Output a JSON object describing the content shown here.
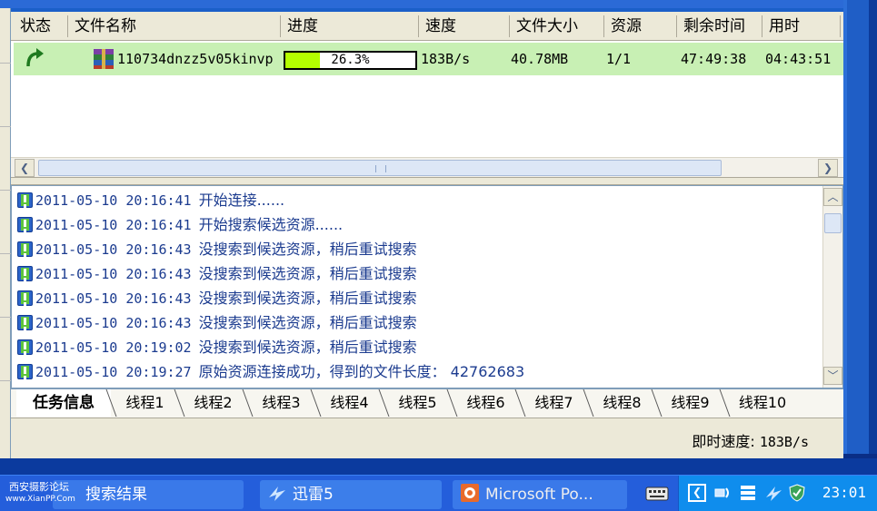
{
  "columns": [
    "状态",
    "文件名称",
    "进度",
    "速度",
    "文件大小",
    "资源",
    "剩余时间",
    "用时"
  ],
  "task": {
    "filename": "110734dnzz5v05kinvp",
    "progress_text": "26.3%",
    "progress_value": 0.263,
    "speed": "183B/s",
    "size": "40.78MB",
    "sources": "1/1",
    "remaining": "47:49:38",
    "elapsed": "04:43:51"
  },
  "log": [
    {
      "ts": "2011-05-10 20:16:41",
      "msg": "开始连接......"
    },
    {
      "ts": "2011-05-10 20:16:41",
      "msg": "开始搜索候选资源......"
    },
    {
      "ts": "2011-05-10 20:16:43",
      "msg": "没搜索到候选资源，稍后重试搜索"
    },
    {
      "ts": "2011-05-10 20:16:43",
      "msg": "没搜索到候选资源，稍后重试搜索"
    },
    {
      "ts": "2011-05-10 20:16:43",
      "msg": "没搜索到候选资源，稍后重试搜索"
    },
    {
      "ts": "2011-05-10 20:16:43",
      "msg": "没搜索到候选资源，稍后重试搜索"
    },
    {
      "ts": "2011-05-10 20:19:02",
      "msg": "没搜索到候选资源，稍后重试搜索"
    },
    {
      "ts": "2011-05-10 20:19:27",
      "msg": "原始资源连接成功，得到的文件长度： 42762683"
    }
  ],
  "tabs": [
    "任务信息",
    "线程1",
    "线程2",
    "线程3",
    "线程4",
    "线程5",
    "线程6",
    "线程7",
    "线程8",
    "线程9",
    "线程10"
  ],
  "status": {
    "label": "即时速度:",
    "value": "183B/s"
  },
  "taskbar": {
    "items": [
      "搜索结果",
      "迅雷5",
      "Microsoft Po..."
    ],
    "clock": "23:01"
  },
  "watermark": {
    "line1": "西安摄影论坛",
    "line2": "www.XianPP.Com"
  },
  "colors": {
    "row_bg": "#c8f0b4",
    "progress_fill": "#b4ff00",
    "log_text": "#1b3b8f",
    "taskbar": "#245edb"
  },
  "icons": {
    "status": "resume-arrow-icon",
    "file": "winrar-archive-icon"
  }
}
